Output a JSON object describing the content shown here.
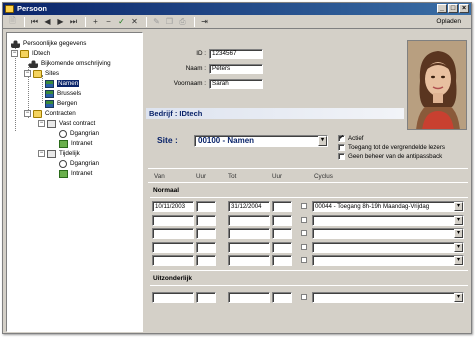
{
  "window": {
    "title": "Persoon",
    "minimize": "_",
    "maximize": "□",
    "close": "×"
  },
  "toolbar": {
    "buttons": [
      {
        "name": "print-icon",
        "glyph": "🗎"
      },
      {
        "name": "first-record-icon",
        "glyph": "⏮"
      },
      {
        "name": "prev-record-icon",
        "glyph": "◀"
      },
      {
        "name": "next-record-icon",
        "glyph": "▶"
      },
      {
        "name": "last-record-icon",
        "glyph": "⏭"
      },
      {
        "name": "add-icon",
        "glyph": "+"
      },
      {
        "name": "delete-icon",
        "glyph": "−"
      },
      {
        "name": "confirm-icon",
        "glyph": "✓"
      },
      {
        "name": "cancel-icon",
        "glyph": "✕"
      },
      {
        "name": "edit-icon",
        "glyph": "✎"
      },
      {
        "name": "copy-icon",
        "glyph": "❐"
      },
      {
        "name": "print2-icon",
        "glyph": "⎙"
      },
      {
        "name": "exit-icon",
        "glyph": "⇥"
      }
    ],
    "opladen": "Opladen"
  },
  "tree": {
    "items": [
      {
        "label": "Persoonlijke gegevens"
      },
      {
        "label": "IDtech",
        "exp": "−"
      },
      {
        "label": "Bijkomende omschrijving"
      },
      {
        "label": "Sites",
        "exp": "−"
      },
      {
        "label": "Namen"
      },
      {
        "label": "Brussels"
      },
      {
        "label": "Bergen"
      },
      {
        "label": "Contracten",
        "exp": "−"
      },
      {
        "label": "Vast contract",
        "exp": "−"
      },
      {
        "label": "Dgangrian"
      },
      {
        "label": "Intranet"
      },
      {
        "label": "Tijdelijk",
        "exp": "−"
      },
      {
        "label": "Dgangrian"
      },
      {
        "label": "Intranet"
      }
    ]
  },
  "person": {
    "id_label": "ID :",
    "id_value": "1234567",
    "naam_label": "Naam :",
    "naam_value": "Peters",
    "voornaam_label": "Voornaam :",
    "voornaam_value": "Sarah"
  },
  "bedrijf": {
    "title": "Bedrijf : IDtech"
  },
  "site": {
    "label": "Site :",
    "value": "00100 - Namen"
  },
  "checks": [
    {
      "label": "Actief",
      "checked": true,
      "mark": "✓"
    },
    {
      "label": "Toegang tot de vergrendelde lezers",
      "checked": false,
      "mark": ""
    },
    {
      "label": "Geen beheer van de antipassback",
      "checked": false,
      "mark": ""
    }
  ],
  "columns": {
    "van": "Van",
    "uur1": "Uur",
    "tot": "Tot",
    "uur2": "Uur",
    "cyclus": "Cyclus"
  },
  "normaal": {
    "title": "Normaal",
    "rows": [
      {
        "van": "10/11/2003",
        "uur1": "",
        "tot": "31/12/2004",
        "uur2": "",
        "cyclus": "00044 - Toegang 8h-19h Maandag-Vrijdag"
      },
      {
        "van": "",
        "uur1": "",
        "tot": "",
        "uur2": "",
        "cyclus": ""
      },
      {
        "van": "",
        "uur1": "",
        "tot": "",
        "uur2": "",
        "cyclus": ""
      },
      {
        "van": "",
        "uur1": "",
        "tot": "",
        "uur2": "",
        "cyclus": ""
      },
      {
        "van": "",
        "uur1": "",
        "tot": "",
        "uur2": "",
        "cyclus": ""
      }
    ]
  },
  "uitzonderlijk": {
    "title": "Uitzonderlijk",
    "rows": [
      {
        "van": "",
        "uur1": "",
        "tot": "",
        "uur2": "",
        "cyclus": ""
      }
    ]
  },
  "dropdown_glyph": "▾"
}
